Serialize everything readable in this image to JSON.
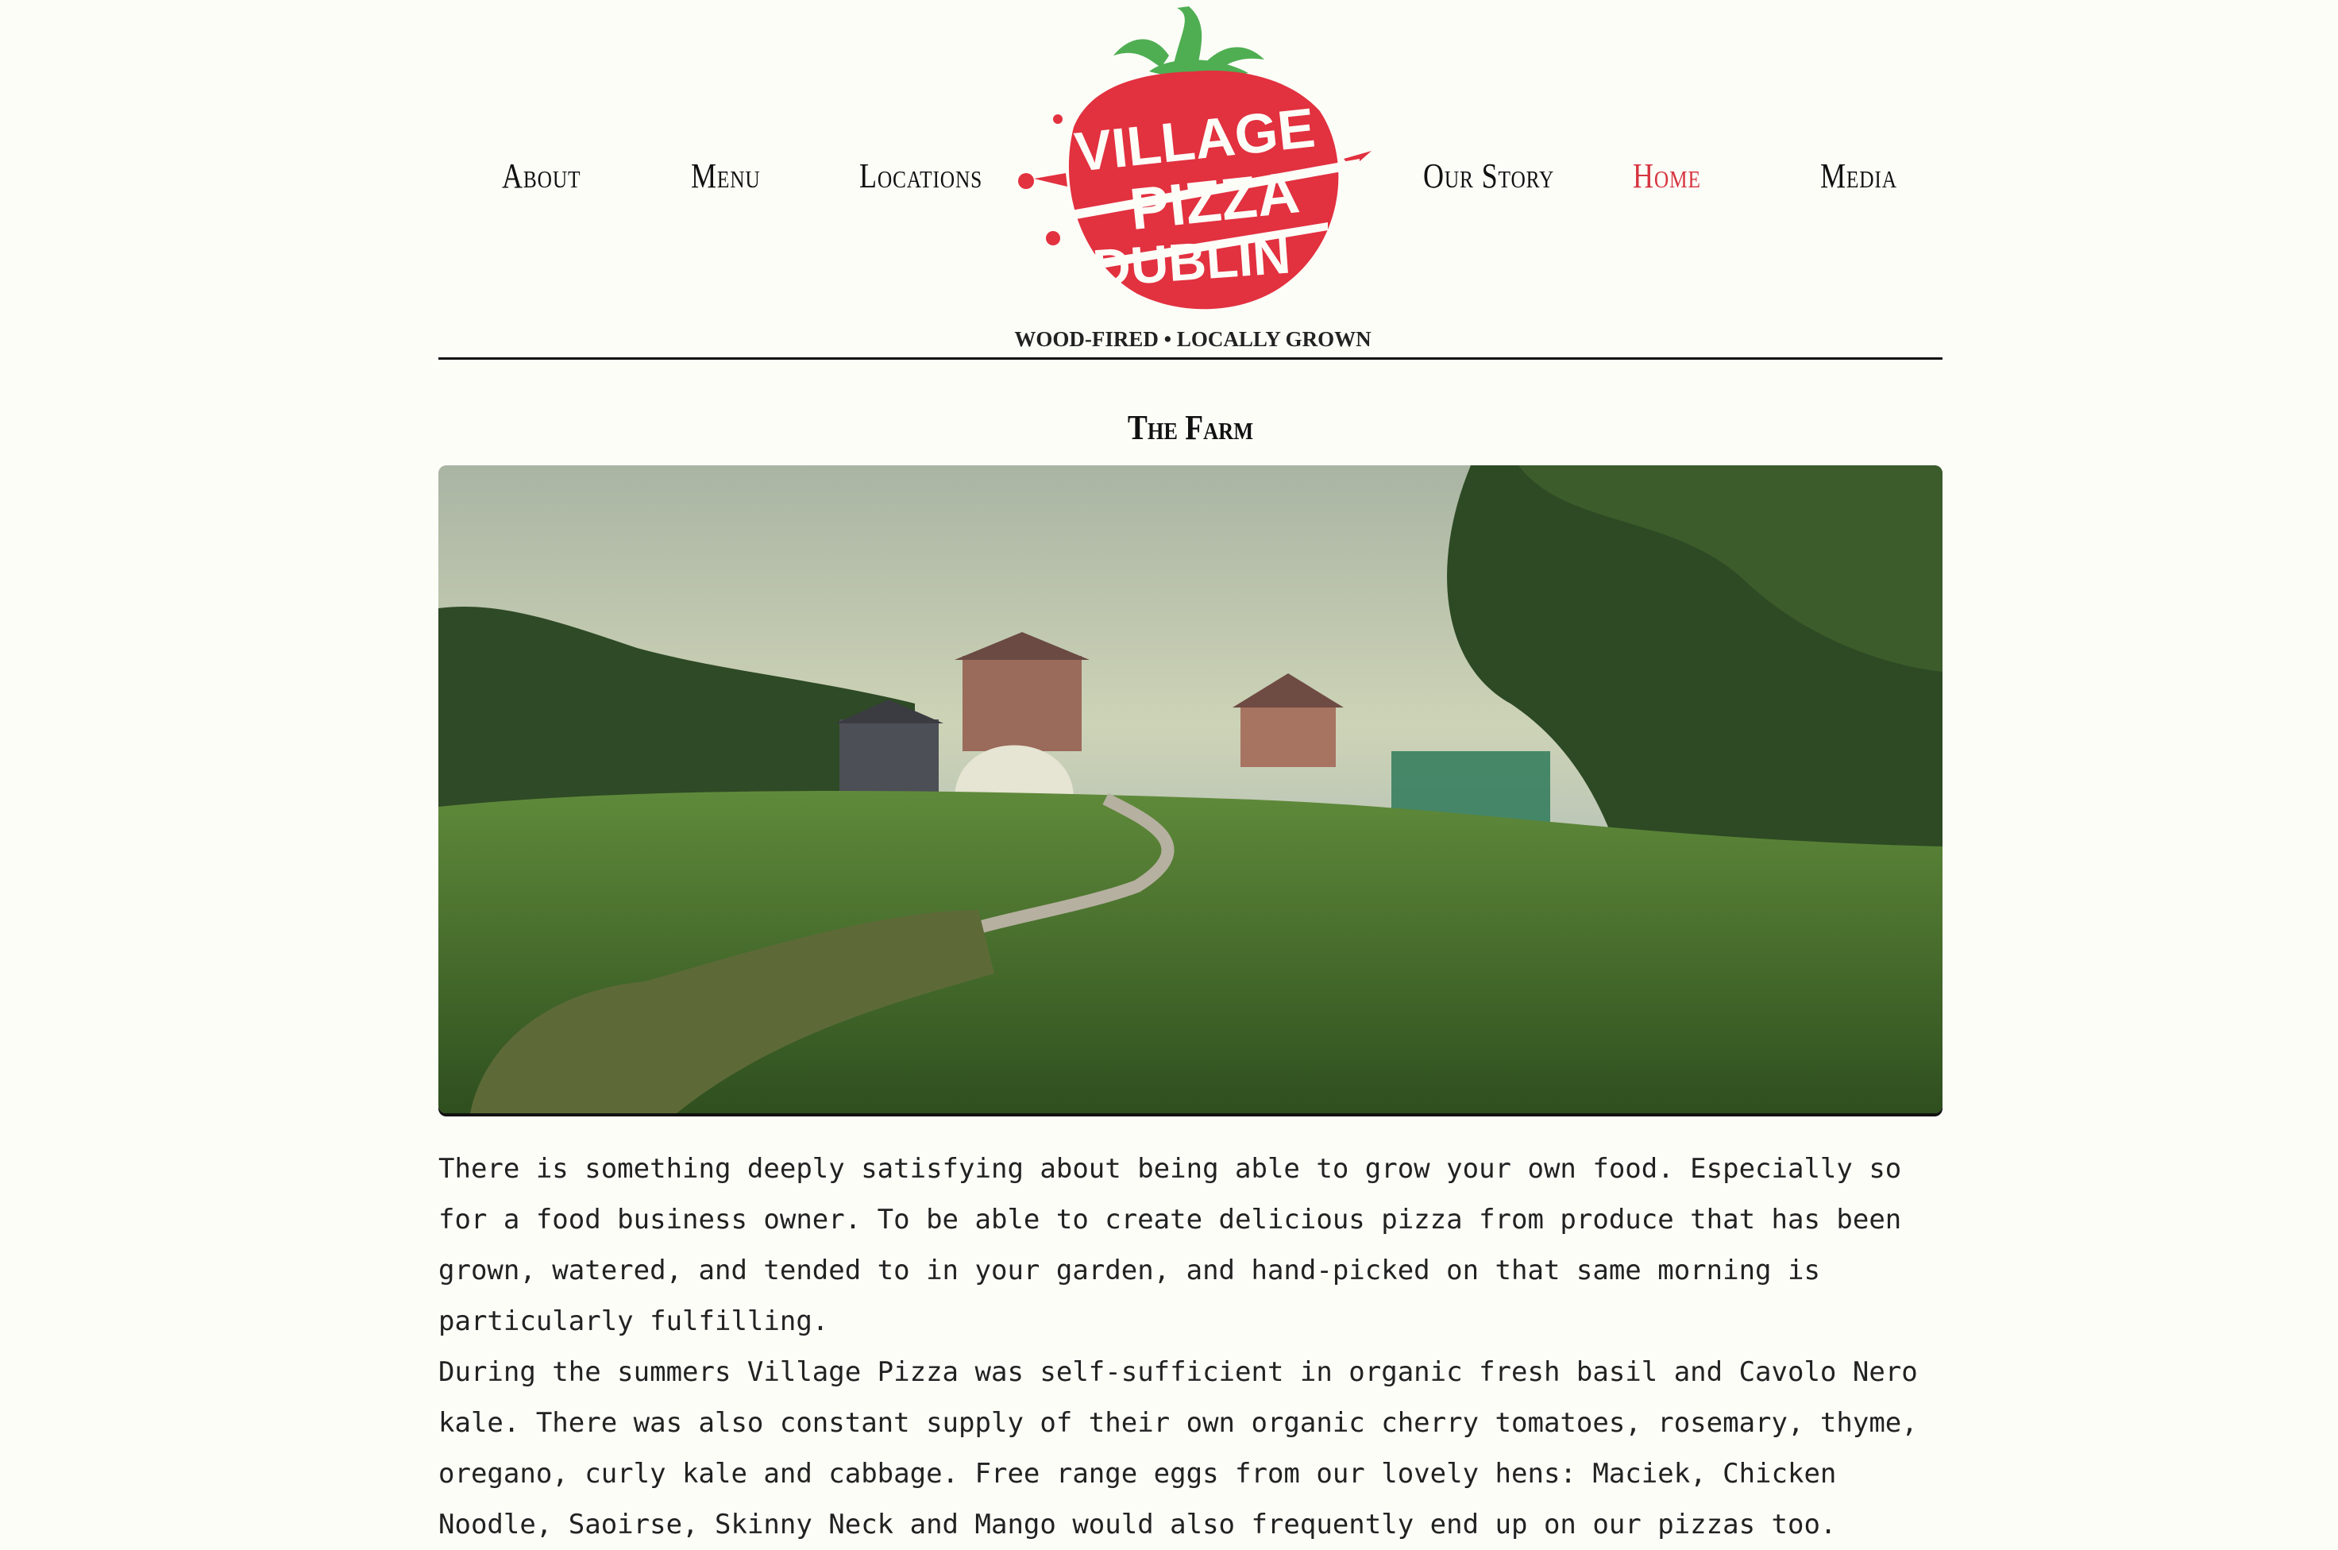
{
  "nav": {
    "left": [
      {
        "label": "About"
      },
      {
        "label": "Menu"
      },
      {
        "label": "Locations"
      }
    ],
    "right": [
      {
        "label": "Our Story"
      },
      {
        "label": "Home",
        "active": true
      },
      {
        "label": "Media"
      }
    ]
  },
  "logo": {
    "line1": "VILLAGE",
    "line2": "PIZZA",
    "line3": "DUBLIN",
    "tagline": "WOOD-FIRED • LOCALLY GROWN",
    "colors": {
      "red": "#e2313f",
      "green": "#4fae52"
    }
  },
  "section": {
    "title": "The Farm"
  },
  "photo": {
    "alt_icon": "farm-garden-photo"
  },
  "content": {
    "p1": "There is something deeply satisfying about being able to grow your own food. Especially so for a food business owner. To be able to create delicious pizza from produce that has been grown, watered, and tended to in your garden, and hand-picked on that same morning is particularly fulfilling.",
    "p2": "During the summers Village Pizza was self-sufficient in organic fresh basil and Cavolo Nero kale. There was also constant supply of their own organic cherry tomatoes, rosemary, thyme, oregano, curly kale and cabbage. Free range eggs from our lovely hens: Maciek, Chicken Noodle, Saoirse, Skinny Neck and Mango would also frequently end up on our pizzas too."
  },
  "colors": {
    "accent": "#d6343f",
    "background": "#fdfdf8",
    "text": "#222222"
  }
}
